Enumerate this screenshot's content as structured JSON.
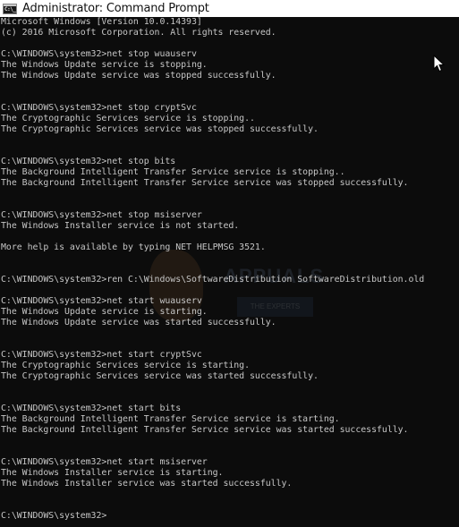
{
  "window": {
    "title": "Administrator: Command Prompt",
    "icon": "cmd-icon",
    "icon_label": "C:\\_"
  },
  "console": {
    "lines": [
      "Microsoft Windows [Version 10.0.14393]",
      "(c) 2016 Microsoft Corporation. All rights reserved.",
      "",
      "C:\\WINDOWS\\system32>net stop wuauserv",
      "The Windows Update service is stopping.",
      "The Windows Update service was stopped successfully.",
      "",
      "",
      "C:\\WINDOWS\\system32>net stop cryptSvc",
      "The Cryptographic Services service is stopping..",
      "The Cryptographic Services service was stopped successfully.",
      "",
      "",
      "C:\\WINDOWS\\system32>net stop bits",
      "The Background Intelligent Transfer Service service is stopping..",
      "The Background Intelligent Transfer Service service was stopped successfully.",
      "",
      "",
      "C:\\WINDOWS\\system32>net stop msiserver",
      "The Windows Installer service is not started.",
      "",
      "More help is available by typing NET HELPMSG 3521.",
      "",
      "",
      "C:\\WINDOWS\\system32>ren C:\\Windows\\SoftwareDistribution SoftwareDistribution.old",
      "",
      "C:\\WINDOWS\\system32>net start wuauserv",
      "The Windows Update service is starting.",
      "The Windows Update service was started successfully.",
      "",
      "",
      "C:\\WINDOWS\\system32>net start cryptSvc",
      "The Cryptographic Services service is starting.",
      "The Cryptographic Services service was started successfully.",
      "",
      "",
      "C:\\WINDOWS\\system32>net start bits",
      "The Background Intelligent Transfer Service service is starting.",
      "The Background Intelligent Transfer Service service was started successfully.",
      "",
      "",
      "C:\\WINDOWS\\system32>net start msiserver",
      "The Windows Installer service is starting.",
      "The Windows Installer service was started successfully.",
      "",
      "",
      "C:\\WINDOWS\\system32>"
    ]
  },
  "watermark": {
    "brand": "APPUALS",
    "tagline": "THE EXPERTS"
  },
  "colors": {
    "console_bg": "#0c0c0c",
    "console_text": "#c6c6c6",
    "titlebar_bg": "#ffffff"
  }
}
